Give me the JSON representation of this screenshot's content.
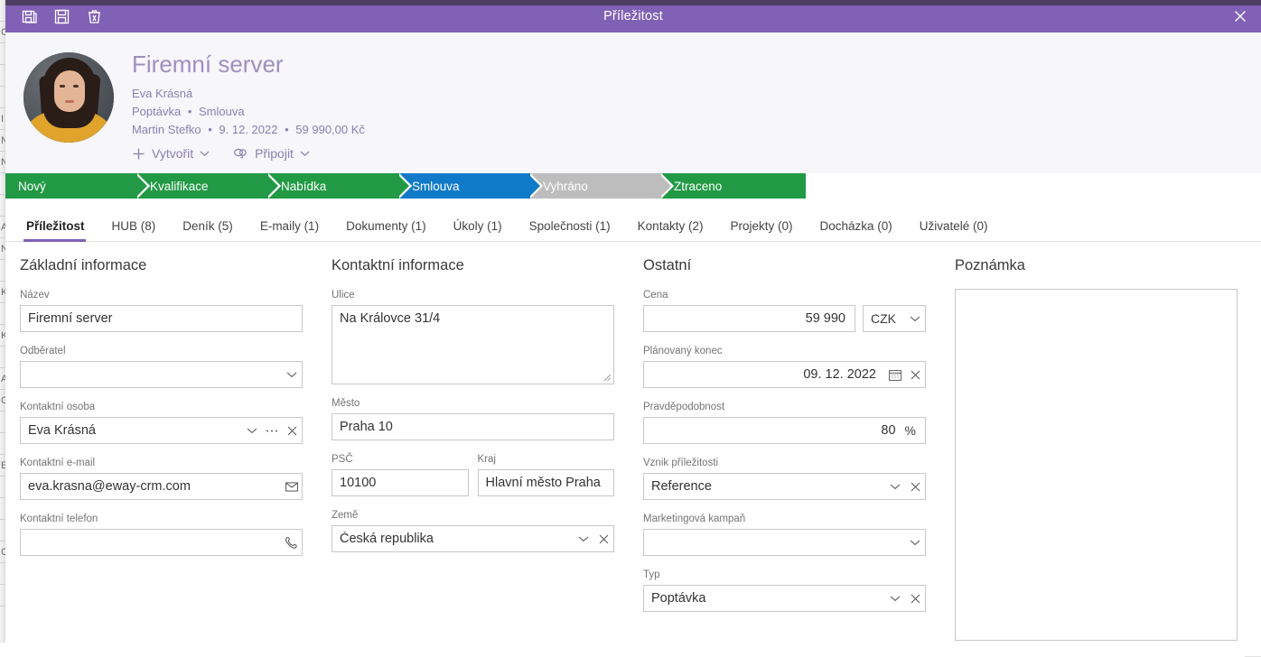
{
  "window": {
    "title": "Příležitost",
    "close_icon": "close-icon",
    "toolbar_icons": [
      {
        "name": "save-and-new-icon",
        "label": "Uložit a nový"
      },
      {
        "name": "save-icon",
        "label": "Uložit"
      },
      {
        "name": "delete-icon",
        "label": "Odstranit"
      }
    ]
  },
  "header": {
    "record_title": "Firemní server",
    "contact": "Eva Krásná",
    "type": "Poptávka",
    "stage": "Smlouva",
    "owner": "Martin Stefko",
    "date": "9. 12. 2022",
    "amount": "59 990,00 Kč",
    "separator": "•",
    "actions": [
      {
        "name": "create-button",
        "label": "Vytvořit",
        "icon": "plus-icon",
        "chevron": "chevron-down-icon"
      },
      {
        "name": "attach-button",
        "label": "Připojit",
        "icon": "link-icon",
        "chevron": "chevron-down-icon"
      }
    ]
  },
  "stages": [
    {
      "label": "Nový",
      "state": "done",
      "color": "#229a45"
    },
    {
      "label": "Kvalifikace",
      "state": "done",
      "color": "#229a45"
    },
    {
      "label": "Nabídka",
      "state": "done",
      "color": "#229a45"
    },
    {
      "label": "Smlouva",
      "state": "current",
      "color": "#0f7ac8"
    },
    {
      "label": "Vyhráno",
      "state": "muted",
      "color": "#bdbdbd"
    },
    {
      "label": "Ztraceno",
      "state": "done",
      "color": "#229a45"
    }
  ],
  "tabs": [
    {
      "label": "Příležitost",
      "active": true
    },
    {
      "label": "HUB (8)",
      "active": false
    },
    {
      "label": "Deník (5)",
      "active": false
    },
    {
      "label": "E-maily (1)",
      "active": false
    },
    {
      "label": "Dokumenty (1)",
      "active": false
    },
    {
      "label": "Úkoly (1)",
      "active": false
    },
    {
      "label": "Společnosti (1)",
      "active": false
    },
    {
      "label": "Kontakty (2)",
      "active": false
    },
    {
      "label": "Projekty (0)",
      "active": false
    },
    {
      "label": "Docházka (0)",
      "active": false
    },
    {
      "label": "Uživatelé (0)",
      "active": false
    }
  ],
  "basic": {
    "section": "Základní informace",
    "name_label": "Název",
    "name_value": "Firemní server",
    "customer_label": "Odběratel",
    "customer_value": "",
    "contact_person_label": "Kontaktní osoba",
    "contact_person_value": "Eva Krásná",
    "email_label": "Kontaktní e-mail",
    "email_value": "eva.krasna@eway-crm.com",
    "phone_label": "Kontaktní telefon",
    "phone_value": ""
  },
  "contact": {
    "section": "Kontaktní informace",
    "street_label": "Ulice",
    "street_value": "Na Královce 31/4",
    "city_label": "Město",
    "city_value": "Praha 10",
    "zip_label": "PSČ",
    "zip_value": "10100",
    "region_label": "Kraj",
    "region_value": "Hlavní město Praha",
    "country_label": "Země",
    "country_value": "Česká republika"
  },
  "other": {
    "section": "Ostatní",
    "price_label": "Cena",
    "price_value": "59 990",
    "currency_value": "CZK",
    "end_label": "Plánovaný konec",
    "end_value": "09. 12. 2022",
    "probability_label": "Pravděpodobnost",
    "probability_value": "80",
    "probability_unit": "%",
    "origin_label": "Vznik příležitosti",
    "origin_value": "Reference",
    "campaign_label": "Marketingová kampaň",
    "campaign_value": "",
    "type_label": "Typ",
    "type_value": "Poptávka"
  },
  "note": {
    "section": "Poznámka",
    "value": ""
  },
  "colors": {
    "title_bar": "#8061b5",
    "accent": "#8061b5",
    "stage_done": "#229a45",
    "stage_current": "#0f7ac8",
    "stage_muted": "#bdbdbd",
    "header_bg": "#f6f6fb"
  }
}
